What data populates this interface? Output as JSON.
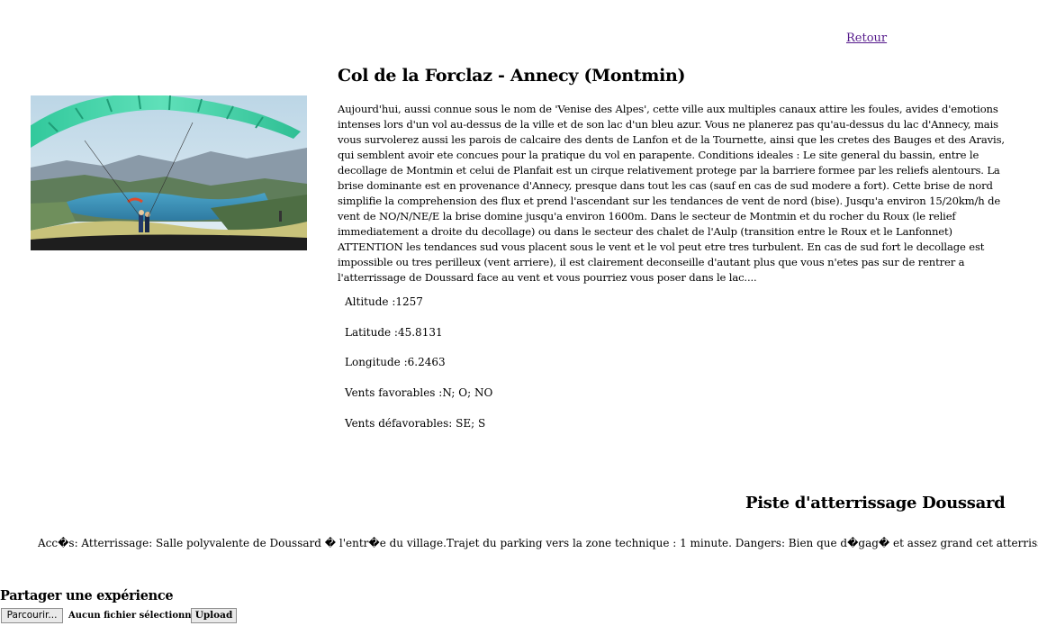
{
  "nav": {
    "back_label": "Retour"
  },
  "site": {
    "title": "Col de la Forclaz - Annecy (Montmin)",
    "description": "Aujourd'hui, aussi connue sous le nom de 'Venise des Alpes', cette ville aux multiples canaux attire les foules, avides d'emotions intenses lors d'un vol au-dessus de la ville et de son lac d'un bleu azur. Vous ne planerez pas qu'au-dessus du lac d'Annecy, mais vous survolerez aussi les parois de calcaire des dents de Lanfon et de la Tournette, ainsi que les cretes des Bauges et des Aravis, qui semblent avoir ete concues pour la pratique du vol en parapente. Conditions ideales : Le site general du bassin, entre le decollage de Montmin et celui de Planfait est un cirque relativement protege par la barriere formee par les reliefs alentours. La brise dominante est en provenance d'Annecy, presque dans tout les cas (sauf en cas de sud modere a fort). Cette brise de nord simplifie la comprehension des flux et prend l'ascendant sur les tendances de vent de nord (bise). Jusqu'a environ 15/20km/h de vent de NO/N/NE/E la brise domine jusqu'a environ 1600m. Dans le secteur de Montmin et du rocher du Roux (le relief immediatement a droite du decollage) ou dans le secteur des chalet de l'Aulp (transition entre le Roux et le Lanfonnet) ATTENTION les tendances sud vous placent sous le vent et le vol peut etre tres turbulent. En cas de sud fort le decollage est impossible ou tres perilleux (vent arriere), il est clairement deconseille d'autant plus que vous n'etes pas sur de rentrer a l'atterrissage de Doussard face au vent et vous pourriez vous poser dans le lac....",
    "photo_alt": "paragliding-photo"
  },
  "info": {
    "altitude": "Altitude :1257",
    "latitude": "Latitude :45.8131",
    "longitude": "Longitude :6.2463",
    "favorable_winds": "Vents favorables :N; O; NO",
    "unfavorable_winds": "Vents défavorables: SE; S"
  },
  "landing": {
    "title": "Piste d'atterrissage Doussard",
    "text": "Acc�s: Atterrissage: Salle polyvalente de Doussard � l'entr�e du village.Trajet du parking vers la zone technique : 1 minute. Dangers: Bien que d�gag� et assez grand cet atterrissage est tr�s"
  },
  "share": {
    "title": "Partager une expérience",
    "browse_label": "Parcourir...",
    "file_status": "Aucun fichier sélectionné.",
    "upload_label": "Upload"
  },
  "colors": {
    "link": "#551a8b",
    "sky": "#cfe3ee",
    "wing": "#3fd1a6",
    "lake": "#3e8fb5"
  }
}
